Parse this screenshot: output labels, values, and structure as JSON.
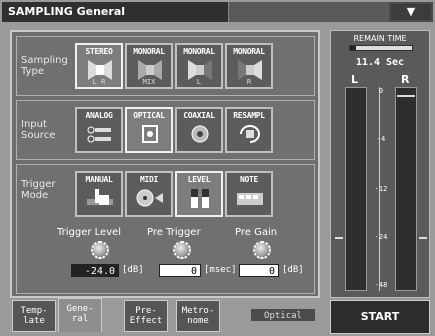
{
  "window": {
    "title": "SAMPLING General"
  },
  "sampling_type": {
    "label": "Sampling\nType",
    "options": [
      {
        "label": "STEREO",
        "sub": "L  R",
        "icon": "stereo-speaker-icon",
        "active": true
      },
      {
        "label": "MONORAL",
        "sub": "MIX",
        "icon": "mono-mix-speaker-icon",
        "active": false
      },
      {
        "label": "MONORAL",
        "sub": "L",
        "icon": "mono-left-speaker-icon",
        "active": false
      },
      {
        "label": "MONORAL",
        "sub": "R",
        "icon": "mono-right-speaker-icon",
        "active": false
      }
    ]
  },
  "input_source": {
    "label": "Input\nSource",
    "options": [
      {
        "label": "ANALOG",
        "icon": "analog-plug-icon",
        "active": false
      },
      {
        "label": "OPTICAL",
        "icon": "optical-port-icon",
        "active": true
      },
      {
        "label": "COAXIAL",
        "icon": "coaxial-jack-icon",
        "active": false
      },
      {
        "label": "RESAMPL",
        "icon": "resample-loop-icon",
        "active": false
      }
    ]
  },
  "trigger_mode": {
    "label": "Trigger\nMode",
    "options": [
      {
        "label": "MANUAL",
        "icon": "hand-press-icon",
        "active": false
      },
      {
        "label": "MIDI",
        "icon": "midi-plug-icon",
        "active": false
      },
      {
        "label": "LEVEL",
        "icon": "level-meter-icon",
        "active": true
      },
      {
        "label": "NOTE",
        "icon": "note-pads-icon",
        "active": false
      }
    ]
  },
  "params": {
    "trigger_level": {
      "label": "Trigger Level",
      "value": "-24.0",
      "unit": "[dB]"
    },
    "pre_trigger": {
      "label": "Pre Trigger",
      "value": "0",
      "unit": "[msec]"
    },
    "pre_gain": {
      "label": "Pre Gain",
      "value": "0",
      "unit": "[dB]"
    }
  },
  "tabs": [
    {
      "label": "Temp-\nlate",
      "active": false
    },
    {
      "label": "Gene-\nral",
      "active": true
    },
    {
      "label": "Pre-\nEffect",
      "active": false
    },
    {
      "label": "Metro-\nnome",
      "active": false
    }
  ],
  "status_source": "Optical",
  "remain": {
    "title": "REMAIN TIME",
    "value": "11.4 Sec",
    "fraction": 0.1
  },
  "meter": {
    "left_label": "L",
    "right_label": "R",
    "ticks": [
      "0",
      "-4",
      "-12",
      "-24",
      "-48"
    ]
  },
  "start_label": "START"
}
